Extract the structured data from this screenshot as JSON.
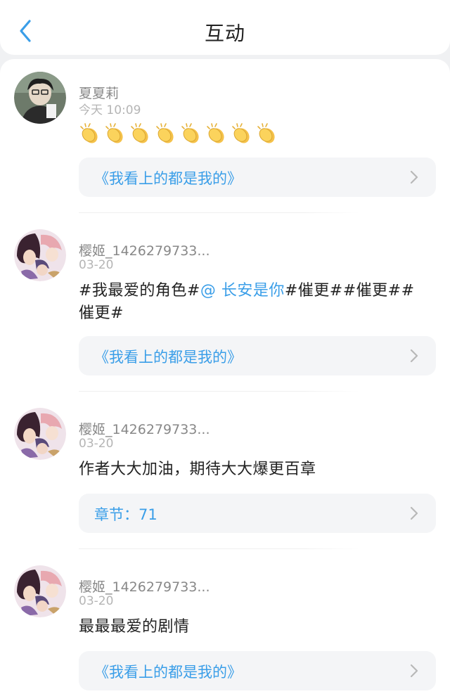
{
  "header": {
    "title": "互动",
    "back_icon": "chevron-left-icon",
    "accent": "#3a9ee8"
  },
  "posts": [
    {
      "username": "夏夏莉",
      "time": "今天 10:09",
      "emoji": "clapping-hands",
      "emoji_count": 8,
      "link": "《我看上的都是我的》"
    },
    {
      "username": "樱姬_1426279733...",
      "time": "03-20",
      "text_a": "#我最爱的角色#",
      "mention": "@ 长安是你",
      "text_b": "#催更##催更##",
      "text_c": "催更#",
      "link": "《我看上的都是我的》"
    },
    {
      "username": "樱姬_1426279733...",
      "time": "03-20",
      "text": "作者大大加油，期待大大爆更百章",
      "link": "章节：71"
    },
    {
      "username": "樱姬_1426279733...",
      "time": "03-20",
      "text": "最最最爱的剧情",
      "link": "《我看上的都是我的》"
    }
  ]
}
